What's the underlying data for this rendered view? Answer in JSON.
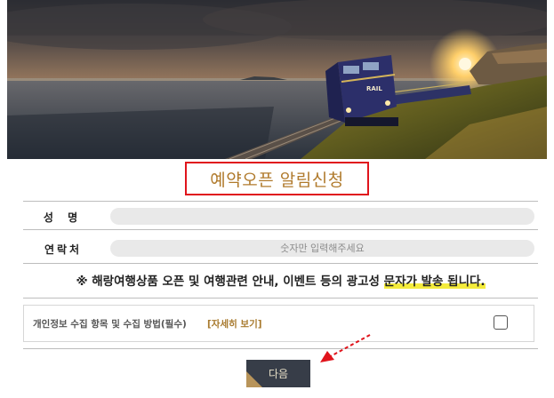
{
  "title": "예약오픈 알림신청",
  "form": {
    "name_label": "성 명",
    "name_value": "",
    "contact_label": "연락처",
    "contact_placeholder": "숫자만 입력해주세요"
  },
  "notice": {
    "prefix": "※ 해랑여행상품 오픈 및 여행관련 안내, 이벤트 등의 광고성 ",
    "highlight": "문자가 발송 됩니다."
  },
  "consent": {
    "text": "개인정보 수집 항목 및 수집 방법(필수)",
    "link": "[자세히 보기]",
    "checked": false
  },
  "next_button": "다음",
  "colors": {
    "title_border": "#e0141c",
    "title_text": "#b07a2c",
    "highlight": "#f4ec3c",
    "button_bg": "#373d48",
    "button_accent": "#b8945a",
    "arrow": "#e0141c"
  },
  "hero": {
    "train_badge": "RAIL"
  }
}
